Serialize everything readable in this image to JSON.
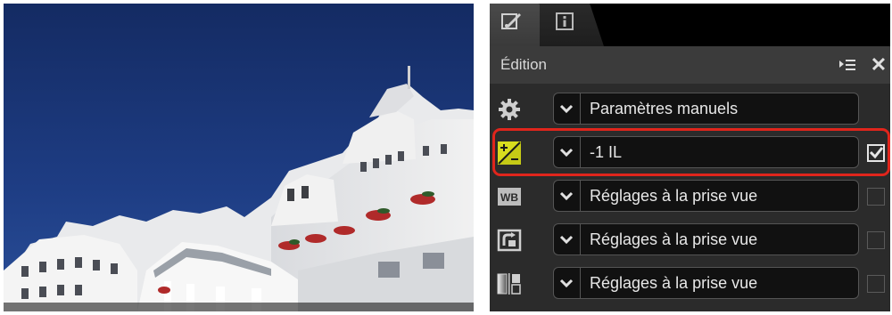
{
  "panel": {
    "tabs": [
      {
        "name": "edit",
        "icon": "brush-edit-icon",
        "active": true
      },
      {
        "name": "info",
        "icon": "info-icon",
        "active": false
      }
    ],
    "header": {
      "title": "Édition",
      "menu_icon": "list-menu-icon",
      "close_icon": "close-icon"
    },
    "rows": [
      {
        "icon": "gear-icon",
        "value": "Paramètres manuels",
        "checkbox": null
      },
      {
        "icon": "exposure-compensation-icon",
        "value": "-1 IL",
        "checkbox": true
      },
      {
        "icon": "white-balance-icon",
        "icon_text": "WB",
        "value": "Réglages à la prise vue",
        "checkbox": false
      },
      {
        "icon": "picture-control-icon",
        "value": "Réglages à la prise vue",
        "checkbox": false
      },
      {
        "icon": "active-d-lighting-icon",
        "value": "Réglages à la prise vue",
        "checkbox": false
      }
    ]
  },
  "colors": {
    "highlight": "#e0251c",
    "sky": "#1c3a7f",
    "panel_bg": "#2b2b2b",
    "exposure_icon": "#d8dc1e"
  }
}
